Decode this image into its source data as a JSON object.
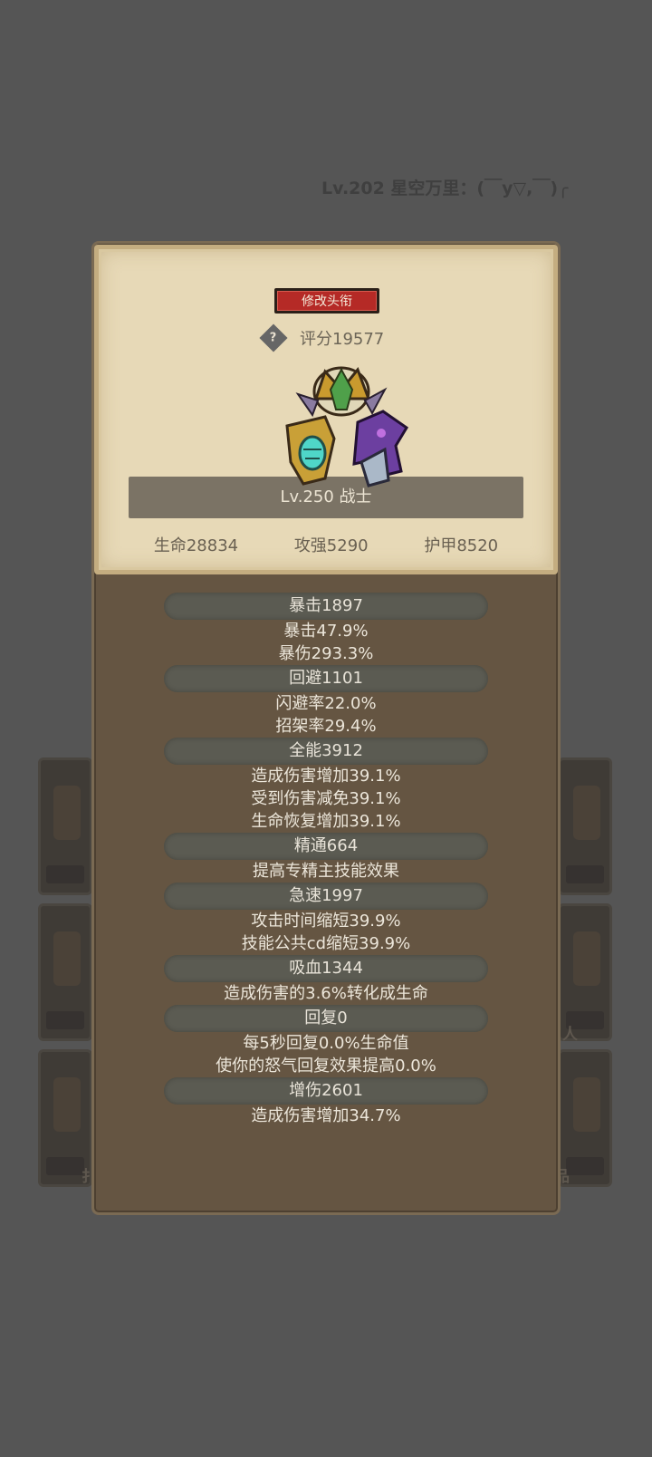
{
  "background": {
    "title": "Lv.202 星空万里：(￣y▽,￣)╭",
    "slot_labels": [
      "扌",
      "人",
      "品"
    ]
  },
  "panel": {
    "rename_button": "修改头衔",
    "help_icon_glyph": "?",
    "score": "评分19577",
    "character_name": "Lv.250 战士",
    "main_stats": [
      "生命28834",
      "攻强5290",
      "护甲8520"
    ]
  },
  "stat_groups": [
    {
      "header": "暴击1897",
      "lines": [
        "暴击47.9%",
        "暴伤293.3%"
      ]
    },
    {
      "header": "回避1101",
      "lines": [
        "闪避率22.0%",
        "招架率29.4%"
      ]
    },
    {
      "header": "全能3912",
      "lines": [
        "造成伤害增加39.1%",
        "受到伤害减免39.1%",
        "生命恢复增加39.1%"
      ]
    },
    {
      "header": "精通664",
      "lines": [
        "提高专精主技能效果"
      ]
    },
    {
      "header": "急速1997",
      "lines": [
        "攻击时间缩短39.9%",
        "技能公共cd缩短39.9%"
      ]
    },
    {
      "header": "吸血1344",
      "lines": [
        "造成伤害的3.6%转化成生命"
      ]
    },
    {
      "header": "回复0",
      "lines": [
        "每5秒回复0.0%生命值",
        "使你的怒气回复效果提高0.0%"
      ]
    },
    {
      "header": "增伤2601",
      "lines": [
        "造成伤害增加34.7%"
      ]
    }
  ],
  "colors": {
    "backdrop": "#555555",
    "panel_brown": "#655542",
    "card_parchment": "#e7d9b7",
    "rename_red": "#b52a26"
  }
}
